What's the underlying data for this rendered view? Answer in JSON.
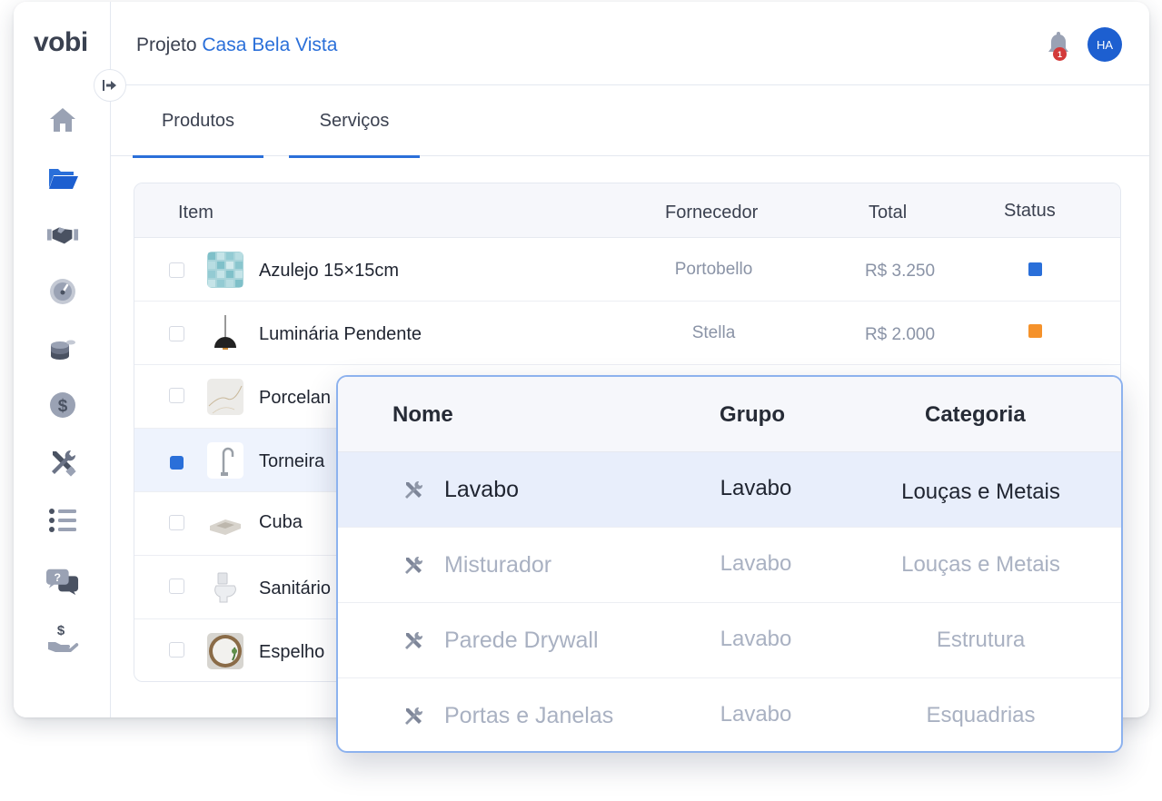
{
  "app": {
    "logo": "vobi"
  },
  "header": {
    "project_prefix": "Projeto",
    "project_name": "Casa Bela Vista",
    "notification_count": "1",
    "avatar_initials": "HA"
  },
  "tabs": [
    {
      "label": "Produtos"
    },
    {
      "label": "Serviços"
    }
  ],
  "sidebar": {
    "items": [
      {
        "icon": "home-icon"
      },
      {
        "icon": "folder-icon"
      },
      {
        "icon": "handshake-icon"
      },
      {
        "icon": "gauge-icon"
      },
      {
        "icon": "coins-icon"
      },
      {
        "icon": "dollar-icon"
      },
      {
        "icon": "tools-icon"
      },
      {
        "icon": "list-icon"
      },
      {
        "icon": "chat-help-icon"
      },
      {
        "icon": "hand-money-icon"
      }
    ]
  },
  "products_table": {
    "headers": {
      "item": "Item",
      "supplier": "Fornecedor",
      "total": "Total",
      "status": "Status"
    },
    "rows": [
      {
        "name": "Azulejo 15×15cm",
        "supplier": "Portobello",
        "total": "R$ 3.250",
        "status_color": "#2a6fd9",
        "checked": false
      },
      {
        "name": "Luminária Pendente",
        "supplier": "Stella",
        "total": "R$ 2.000",
        "status_color": "#f5922b",
        "checked": false
      },
      {
        "name": "Porcelan",
        "checked": false
      },
      {
        "name": "Torneira",
        "checked": true
      },
      {
        "name": "Cuba",
        "checked": false
      },
      {
        "name": "Sanitário",
        "checked": false
      },
      {
        "name": "Espelho",
        "checked": false
      }
    ]
  },
  "services_popup": {
    "headers": {
      "name": "Nome",
      "group": "Grupo",
      "category": "Categoria"
    },
    "rows": [
      {
        "name": "Lavabo",
        "group": "Lavabo",
        "category": "Louças e Metais"
      },
      {
        "name": "Misturador",
        "group": "Lavabo",
        "category": "Louças e Metais"
      },
      {
        "name": "Parede Drywall",
        "group": "Lavabo",
        "category": "Estrutura"
      },
      {
        "name": "Portas e Janelas",
        "group": "Lavabo",
        "category": "Esquadrias"
      }
    ]
  },
  "colors": {
    "accent": "#2a6fd9",
    "status_blue": "#2a6fd9",
    "status_orange": "#f5922b"
  }
}
